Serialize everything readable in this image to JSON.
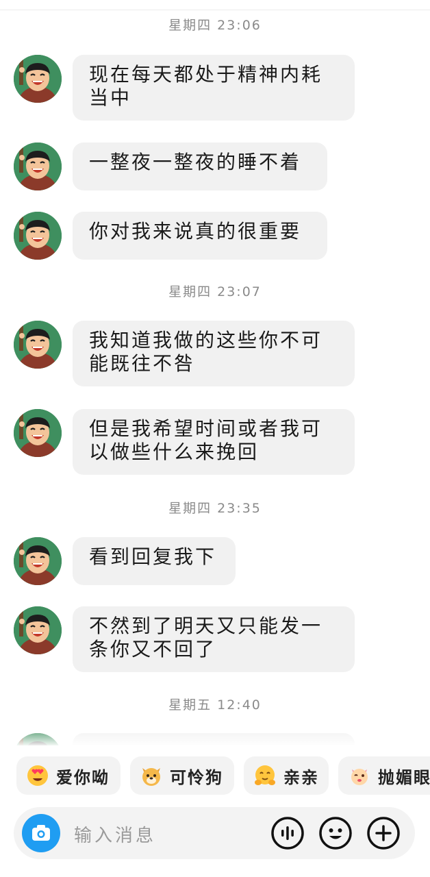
{
  "timestamps": [
    "星期四 23:06",
    "星期四 23:07",
    "星期四 23:35",
    "星期五 12:40"
  ],
  "messages": [
    {
      "line1": "现在每天都处于精神内耗",
      "line2": "当中"
    },
    {
      "line1": "一整夜一整夜的睡不着",
      "line2": ""
    },
    {
      "line1": "你对我来说真的很重要",
      "line2": ""
    },
    {
      "line1": "我知道我做的这些你不可",
      "line2": "能既往不咎"
    },
    {
      "line1": "但是我希望时间或者我可",
      "line2": "以做些什么来挽回"
    },
    {
      "line1": "看到回复我下",
      "line2": ""
    },
    {
      "line1": "不然到了明天又只能发一",
      "line2": "条你又不回了"
    }
  ],
  "quick_replies": [
    {
      "label": "爱你呦",
      "icon": "heart-eyes-icon"
    },
    {
      "label": "可怜狗",
      "icon": "puppy-face-icon"
    },
    {
      "label": "亲亲",
      "icon": "hugging-face-icon"
    },
    {
      "label": "抛媚眼",
      "icon": "wink-face-icon"
    }
  ],
  "input": {
    "placeholder": "输入消息"
  },
  "colors": {
    "bubble": "#f1f1f1",
    "camera": "#1f9df2",
    "timestamp": "#8a8a8a"
  }
}
